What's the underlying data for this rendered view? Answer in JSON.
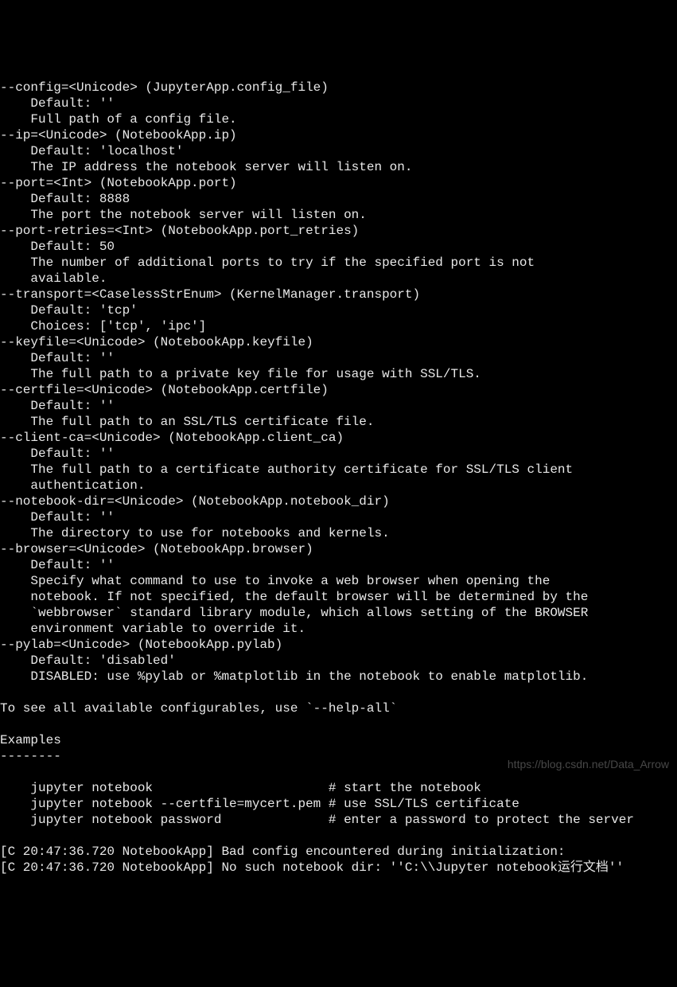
{
  "terminal": {
    "lines": [
      "--config=<Unicode> (JupyterApp.config_file)",
      "    Default: ''",
      "    Full path of a config file.",
      "--ip=<Unicode> (NotebookApp.ip)",
      "    Default: 'localhost'",
      "    The IP address the notebook server will listen on.",
      "--port=<Int> (NotebookApp.port)",
      "    Default: 8888",
      "    The port the notebook server will listen on.",
      "--port-retries=<Int> (NotebookApp.port_retries)",
      "    Default: 50",
      "    The number of additional ports to try if the specified port is not",
      "    available.",
      "--transport=<CaselessStrEnum> (KernelManager.transport)",
      "    Default: 'tcp'",
      "    Choices: ['tcp', 'ipc']",
      "--keyfile=<Unicode> (NotebookApp.keyfile)",
      "    Default: ''",
      "    The full path to a private key file for usage with SSL/TLS.",
      "--certfile=<Unicode> (NotebookApp.certfile)",
      "    Default: ''",
      "    The full path to an SSL/TLS certificate file.",
      "--client-ca=<Unicode> (NotebookApp.client_ca)",
      "    Default: ''",
      "    The full path to a certificate authority certificate for SSL/TLS client",
      "    authentication.",
      "--notebook-dir=<Unicode> (NotebookApp.notebook_dir)",
      "    Default: ''",
      "    The directory to use for notebooks and kernels.",
      "--browser=<Unicode> (NotebookApp.browser)",
      "    Default: ''",
      "    Specify what command to use to invoke a web browser when opening the",
      "    notebook. If not specified, the default browser will be determined by the",
      "    `webbrowser` standard library module, which allows setting of the BROWSER",
      "    environment variable to override it.",
      "--pylab=<Unicode> (NotebookApp.pylab)",
      "    Default: 'disabled'",
      "    DISABLED: use %pylab or %matplotlib in the notebook to enable matplotlib.",
      "",
      "To see all available configurables, use `--help-all`",
      "",
      "Examples",
      "--------",
      "",
      "    jupyter notebook                       # start the notebook",
      "    jupyter notebook --certfile=mycert.pem # use SSL/TLS certificate",
      "    jupyter notebook password              # enter a password to protect the server",
      "",
      "[C 20:47:36.720 NotebookApp] Bad config encountered during initialization:",
      "[C 20:47:36.720 NotebookApp] No such notebook dir: ''C:\\\\Jupyter notebook运行文档''"
    ]
  },
  "watermark": {
    "text": "https://blog.csdn.net/Data_Arrow"
  }
}
